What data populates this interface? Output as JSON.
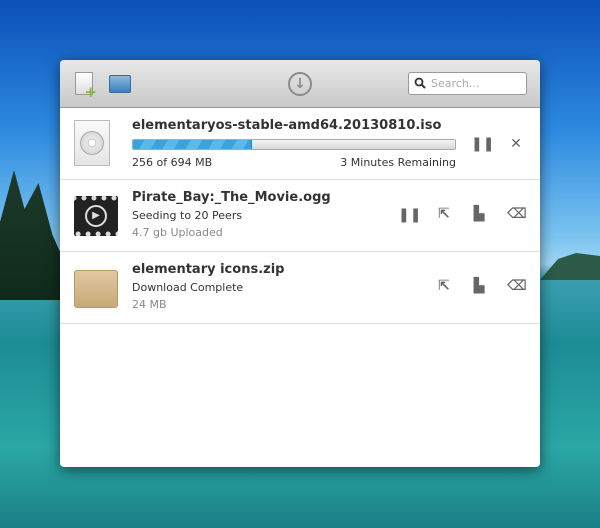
{
  "toolbar": {
    "search_placeholder": "Search...",
    "icons": [
      "new-file-icon",
      "open-folder-icon",
      "download-icon",
      "search-icon"
    ]
  },
  "downloads": [
    {
      "name": "elementaryos-stable-amd64.20130810.iso",
      "progress_text": "256 of 694 MB",
      "remaining": "3 Minutes Remaining",
      "progress": 0.369,
      "icon": "disc-icon"
    },
    {
      "name": "Pirate_Bay:_The_Movie.ogg",
      "status": "Seeding to 20 Peers",
      "detail": "4.7 gb Uploaded",
      "icon": "video-icon"
    },
    {
      "name": "elementary icons.zip",
      "status": "Download Complete",
      "detail": "24 MB",
      "icon": "archive-icon"
    }
  ],
  "colors": {
    "progress": "#3aa3dc"
  }
}
